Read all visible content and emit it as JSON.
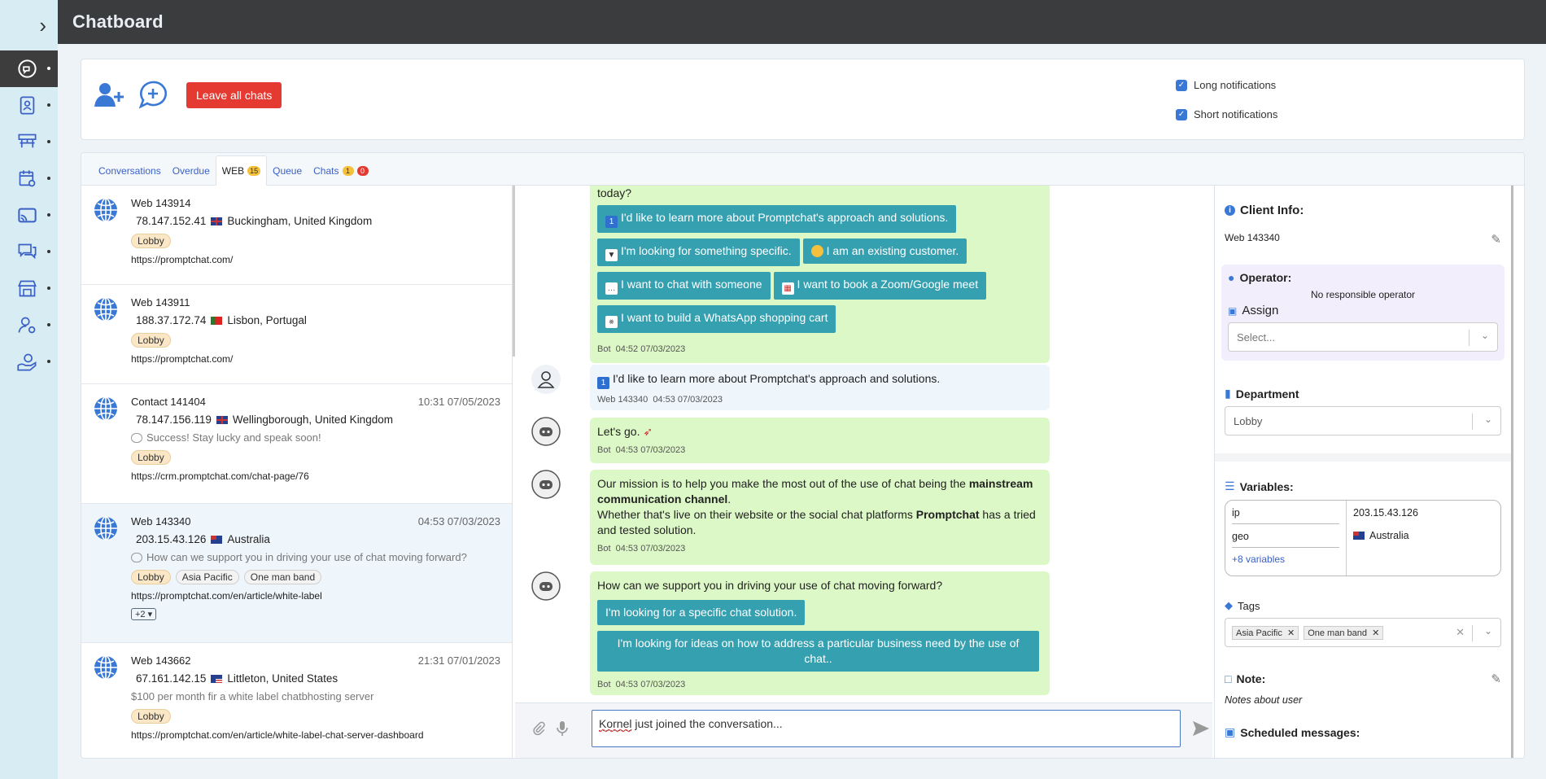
{
  "app": {
    "title": "Chatboard"
  },
  "toolbar": {
    "leave_label": "Leave all chats",
    "long_notifications": "Long notifications",
    "short_notifications": "Short notifications"
  },
  "tabs": [
    {
      "label": "Conversations"
    },
    {
      "label": "Overdue"
    },
    {
      "label": "WEB",
      "badge": "15"
    },
    {
      "label": "Queue"
    },
    {
      "label": "Chats",
      "badge": "1",
      "badge2": "0"
    }
  ],
  "conversations": [
    {
      "name": "Web 143914",
      "time": "",
      "ip": "78.147.152.41",
      "location": "Buckingham, United Kingdom",
      "message": "",
      "tags": [
        "Lobby"
      ],
      "url": "https://promptchat.com/"
    },
    {
      "name": "Web 143911",
      "time": "",
      "ip": "188.37.172.74",
      "location": "Lisbon, Portugal",
      "message": "",
      "tags": [
        "Lobby"
      ],
      "url": "https://promptchat.com/"
    },
    {
      "name": "Contact 141404",
      "time": "10:31 07/05/2023",
      "ip": "78.147.156.119",
      "location": "Wellingborough, United Kingdom",
      "message": "Success! Stay lucky and speak soon!",
      "tags": [
        "Lobby"
      ],
      "url": "https://crm.promptchat.com/chat-page/76"
    },
    {
      "name": "Web 143340",
      "time": "04:53 07/03/2023",
      "ip": "203.15.43.126",
      "location": "Australia",
      "message": "How can we support you in driving your use of chat moving forward?",
      "tags": [
        "Lobby",
        "Asia Pacific",
        "One man band"
      ],
      "url": "https://promptchat.com/en/article/white-label",
      "more": "+2"
    },
    {
      "name": "Web 143662",
      "time": "21:31 07/01/2023",
      "ip": "67.161.142.15",
      "location": "Littleton, United States",
      "message": "$100 per month fir a white label chatbhosting server",
      "tags": [
        "Lobby"
      ],
      "url": "https://promptchat.com/en/article/white-label-chat-server-dashboard"
    }
  ],
  "chat": {
    "m1": {
      "partial": "today?",
      "buttons": [
        "I'd like to learn more about Promptchat's approach and solutions.",
        "I'm looking for something specific.",
        "I am an existing customer.",
        "I want to chat with someone",
        "I want to book a Zoom/Google meet",
        "I want to build a WhatsApp shopping cart"
      ],
      "sender": "Bot",
      "time": "04:52 07/03/2023"
    },
    "m2": {
      "text": "I'd like to learn more about Promptchat's approach and solutions.",
      "sender": "Web 143340",
      "time": "04:53 07/03/2023"
    },
    "m3": {
      "text": "Let's go.",
      "sender": "Bot",
      "time": "04:53 07/03/2023"
    },
    "m4": {
      "line1a": "Our mission is to help you make the most out of the use of chat being the ",
      "line1b": "mainstream communication channel",
      "line1c": ".",
      "line2a": "Whether that's live on their website or the social chat platforms ",
      "line2b": "Promptchat",
      "line2c": " has a tried and tested solution.",
      "sender": "Bot",
      "time": "04:53 07/03/2023"
    },
    "m5": {
      "text": "How can we support you in driving your use of chat moving forward?",
      "buttons": [
        "I'm looking for a specific chat solution.",
        "I'm looking for ideas on how to address a particular business need by the use of chat.."
      ],
      "sender": "Bot",
      "time": "04:53 07/03/2023"
    },
    "composer_name": "Kornel",
    "composer_rest": " just joined the conversation..."
  },
  "info": {
    "title": "Client Info:",
    "client_name": "Web 143340",
    "operator_title": "Operator:",
    "operator_value": "No responsible operator",
    "assign_label": "Assign",
    "assign_placeholder": "Select...",
    "department_title": "Department",
    "department_value": "Lobby",
    "variables_title": "Variables:",
    "variables": [
      {
        "key": "ip",
        "value": "203.15.43.126"
      },
      {
        "key": "geo",
        "value": "Australia"
      }
    ],
    "more_variables": "+8 variables",
    "tags_title": "Tags",
    "tags": [
      "Asia Pacific",
      "One man band"
    ],
    "note_title": "Note:",
    "note_value": "Notes about user",
    "scheduled_title": "Scheduled messages:"
  }
}
